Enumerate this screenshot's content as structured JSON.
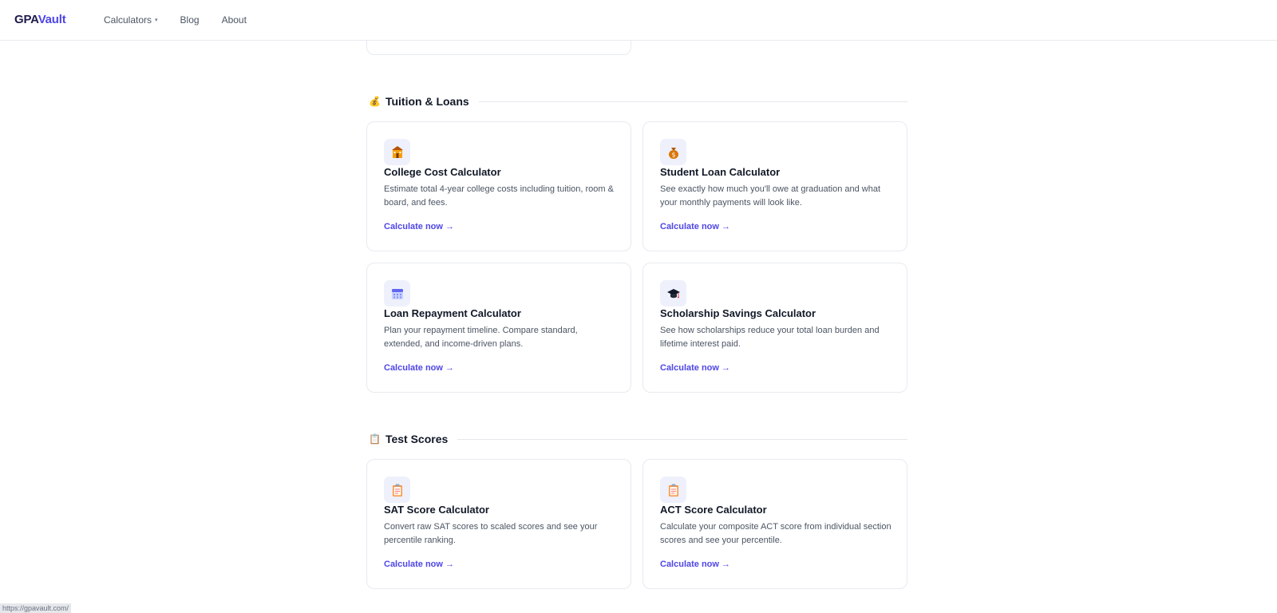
{
  "header": {
    "logo_part1": "GPA",
    "logo_part2": "Vault",
    "nav": {
      "calculators": "Calculators",
      "caret": "▾",
      "blog": "Blog",
      "about": "About"
    }
  },
  "sections": [
    {
      "icon": "money-bag-icon",
      "icon_glyph": "💰",
      "title": "Tuition & Loans",
      "cards": [
        {
          "icon": "school-building-icon",
          "title": "College Cost Calculator",
          "desc": "Estimate total 4-year college costs including tuition, room & board, and fees.",
          "link": "Calculate now →"
        },
        {
          "icon": "money-bag-icon",
          "title": "Student Loan Calculator",
          "desc": "See exactly how much you'll owe at graduation and what your monthly payments will look like.",
          "link": "Calculate now →"
        },
        {
          "icon": "calendar-icon",
          "title": "Loan Repayment Calculator",
          "desc": "Plan your repayment timeline. Compare standard, extended, and income-driven plans.",
          "link": "Calculate now →"
        },
        {
          "icon": "graduation-cap-icon",
          "title": "Scholarship Savings Calculator",
          "desc": "See how scholarships reduce your total loan burden and lifetime interest paid.",
          "link": "Calculate now →"
        }
      ]
    },
    {
      "icon": "clipboard-icon",
      "icon_glyph": "📋",
      "title": "Test Scores",
      "cards": [
        {
          "icon": "clipboard-icon",
          "title": "SAT Score Calculator",
          "desc": "Convert raw SAT scores to scaled scores and see your percentile ranking.",
          "link": "Calculate now →"
        },
        {
          "icon": "clipboard-icon",
          "title": "ACT Score Calculator",
          "desc": "Calculate your composite ACT score from individual section scores and see your percentile.",
          "link": "Calculate now →"
        }
      ]
    }
  ],
  "status_bar": {
    "url": "https://gpavault.com/"
  },
  "colors": {
    "accent": "#4f46e5",
    "logo_dark": "#1e1b4b",
    "icon_bg": "#eef0fb",
    "border": "#e8eaf0"
  }
}
